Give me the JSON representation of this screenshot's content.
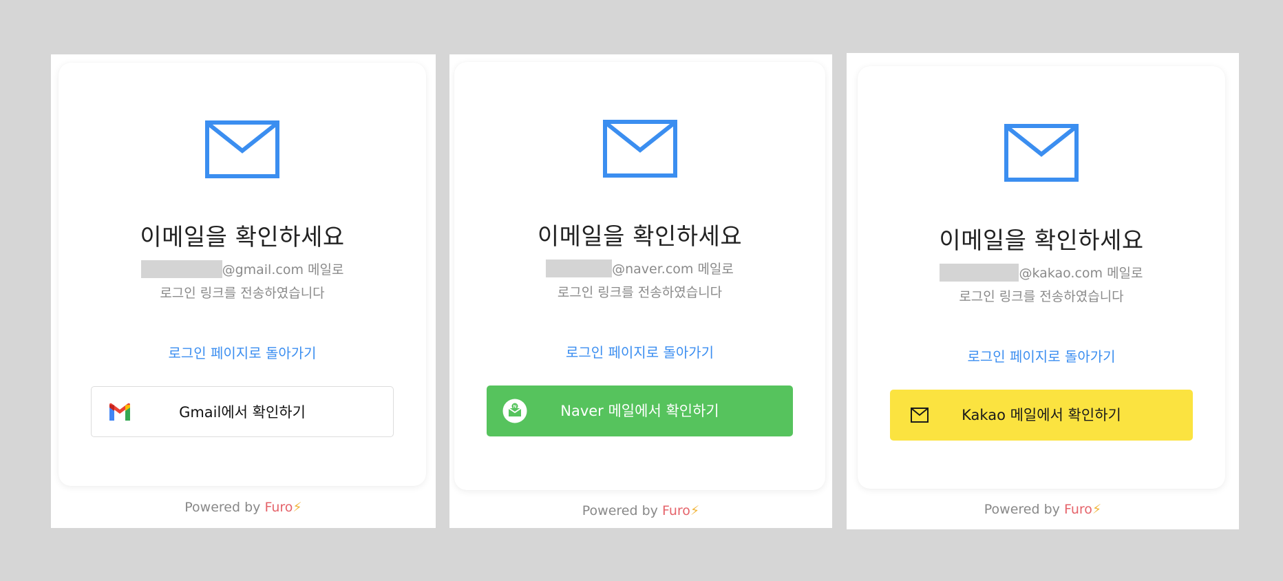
{
  "colors": {
    "background": "#d6d6d6",
    "accent_blue": "#3b8ef0",
    "naver_green": "#56c35d",
    "kakao_yellow": "#fbe340",
    "brand_red": "#e5636a"
  },
  "panels": [
    {
      "provider": "gmail",
      "title": "이메일을 확인하세요",
      "email_domain": "@gmail.com",
      "email_suffix": " 메일로",
      "sent_message": "로그인 링크를 전송하였습니다",
      "back_link": "로그인 페이지로 돌아가기",
      "button_label": "Gmail에서 확인하기",
      "button_icon": "gmail-logo-icon",
      "powered_prefix": "Powered by ",
      "powered_brand": "Furo",
      "powered_mark": "⚡"
    },
    {
      "provider": "naver",
      "title": "이메일을 확인하세요",
      "email_domain": "@naver.com",
      "email_suffix": " 메일로",
      "sent_message": "로그인 링크를 전송하였습니다",
      "back_link": "로그인 페이지로 돌아가기",
      "button_label": "Naver 메일에서 확인하기",
      "button_icon": "naver-mail-icon",
      "powered_prefix": "Powered by ",
      "powered_brand": "Furo",
      "powered_mark": "⚡"
    },
    {
      "provider": "kakao",
      "title": "이메일을 확인하세요",
      "email_domain": "@kakao.com",
      "email_suffix": " 메일로",
      "sent_message": "로그인 링크를 전송하였습니다",
      "back_link": "로그인 페이지로 돌아가기",
      "button_label": "Kakao 메일에서 확인하기",
      "button_icon": "kakao-mail-icon",
      "powered_prefix": "Powered by ",
      "powered_brand": "Furo",
      "powered_mark": "⚡"
    }
  ]
}
